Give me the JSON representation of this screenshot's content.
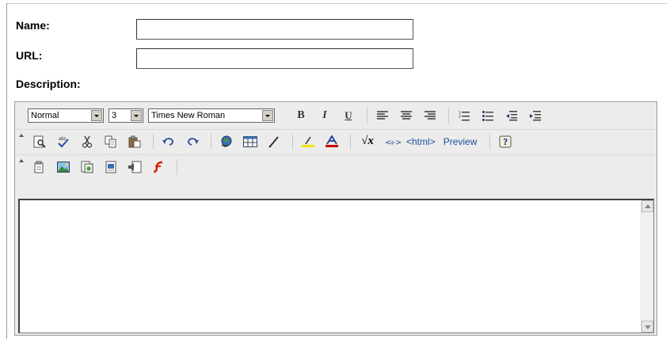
{
  "form": {
    "name_label": "Name:",
    "name_value": "",
    "url_label": "URL:",
    "url_value": "",
    "description_label": "Description:"
  },
  "toolbar": {
    "format_select": "Normal",
    "size_select": "3",
    "font_select": "Times New Roman",
    "bold": "B",
    "italic": "I",
    "underline": "U",
    "sqrt_symbol": "√x",
    "html_label": "<html>",
    "preview_label": "Preview",
    "row1_icons": [
      "align-left-icon",
      "align-center-icon",
      "align-right-icon",
      "ordered-list-icon",
      "unordered-list-icon",
      "outdent-icon",
      "indent-icon"
    ],
    "row2_icons": [
      "find-icon",
      "spellcheck-icon",
      "cut-icon",
      "copy-icon",
      "paste-icon",
      "undo-icon",
      "redo-icon",
      "link-icon",
      "table-icon",
      "pen-icon",
      "highlight-color-icon",
      "font-color-icon",
      "equation-icon",
      "special-char-icon",
      "help-icon"
    ],
    "row3_icons": [
      "document-icon",
      "insert-image-icon",
      "insert-file-icon",
      "insert-page-icon",
      "insert-audio-icon",
      "insert-flash-icon"
    ]
  },
  "colors": {
    "highlight": "#f5e400",
    "font_color": "#d00000",
    "flash": "#e02000",
    "link_text": "#1b4f9c"
  }
}
